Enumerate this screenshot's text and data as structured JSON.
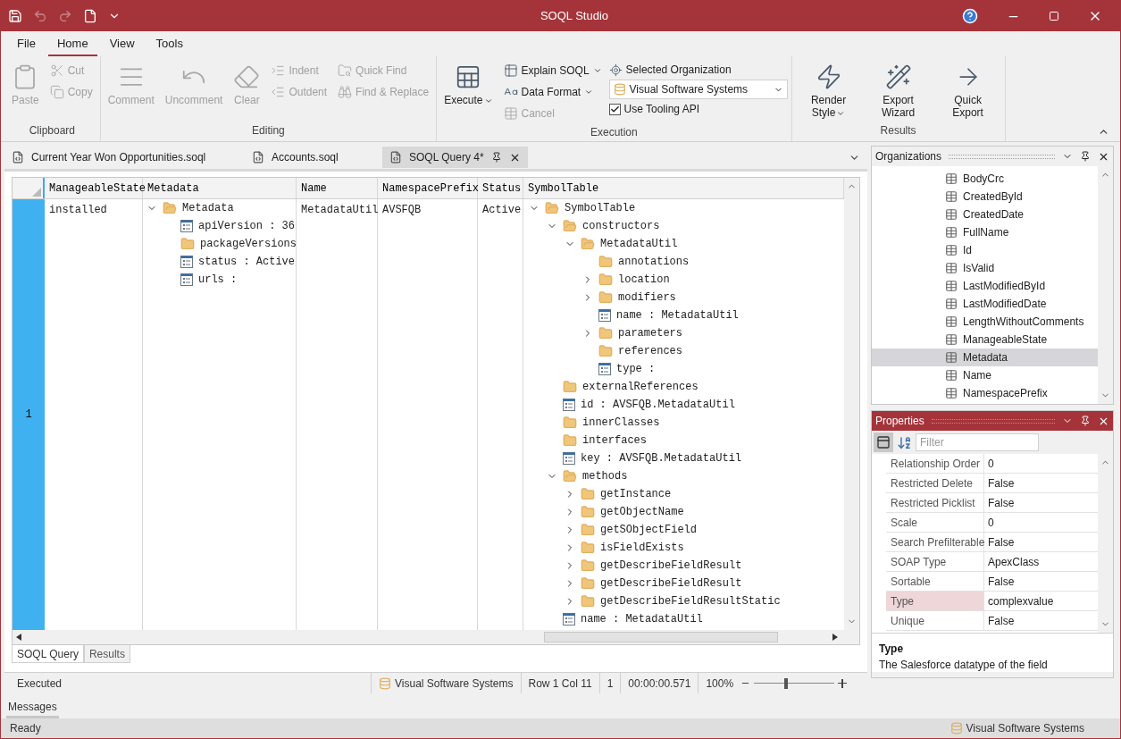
{
  "title_bar": {
    "title": "SOQL Studio"
  },
  "ribbon": {
    "tabs": [
      {
        "label": "File",
        "selected": false
      },
      {
        "label": "Home",
        "selected": true
      },
      {
        "label": "View",
        "selected": false
      },
      {
        "label": "Tools",
        "selected": false
      }
    ],
    "groups": [
      {
        "label": "Clipboard",
        "columns": [
          [
            {
              "kind": "large",
              "label": "Paste",
              "disabled": true,
              "menu": false
            }
          ],
          [
            {
              "kind": "small",
              "label": "Cut",
              "disabled": true,
              "menu": false
            },
            {
              "kind": "small",
              "label": "Copy",
              "disabled": true,
              "menu": false
            }
          ]
        ]
      },
      {
        "label": "Editing",
        "columns": [
          [
            {
              "kind": "large",
              "label": "Comment",
              "disabled": true,
              "menu": false
            }
          ],
          [
            {
              "kind": "large",
              "label": "Uncomment",
              "disabled": true,
              "menu": false
            }
          ],
          [
            {
              "kind": "large",
              "label": "Clear",
              "disabled": true,
              "menu": false
            }
          ],
          [
            {
              "kind": "small",
              "label": "Indent",
              "disabled": true,
              "menu": false
            },
            {
              "kind": "small",
              "label": "Outdent",
              "disabled": true,
              "menu": false
            }
          ],
          [
            {
              "kind": "small",
              "label": "Quick Find",
              "disabled": true,
              "menu": false
            },
            {
              "kind": "small",
              "label": "Find & Replace",
              "disabled": true,
              "menu": false
            }
          ]
        ]
      },
      {
        "label": "Execution",
        "columns": [
          [
            {
              "kind": "large",
              "label": "Execute",
              "disabled": false,
              "menu": true
            }
          ],
          [
            {
              "kind": "small",
              "label": "Explain SOQL",
              "disabled": false,
              "menu": true
            },
            {
              "kind": "small",
              "label": "Data Format",
              "disabled": false,
              "menu": true
            },
            {
              "kind": "small",
              "label": "Cancel",
              "disabled": true,
              "menu": false
            }
          ],
          [
            {
              "kind": "caption",
              "label": "Selected Organization"
            },
            {
              "kind": "combo",
              "value": "Visual Software Systems"
            },
            {
              "kind": "check",
              "label": "Use Tooling API",
              "checked": true
            }
          ]
        ]
      },
      {
        "label": "Results",
        "columns": [
          [
            {
              "kind": "large",
              "label": "Render Style",
              "disabled": false,
              "menu": true
            }
          ],
          [
            {
              "kind": "large",
              "label": "Export Wizard",
              "disabled": false,
              "menu": false
            }
          ],
          [
            {
              "kind": "large",
              "label": "Quick Export",
              "disabled": false,
              "menu": false
            }
          ]
        ]
      }
    ]
  },
  "document_tabs": [
    {
      "label": "Current Year Won Opportunities.soql",
      "selected": false
    },
    {
      "label": "Accounts.soql",
      "selected": false
    },
    {
      "label": "SOQL Query 4*",
      "selected": true
    }
  ],
  "grid": {
    "columns": [
      "ManageableState",
      "Metadata",
      "Name",
      "NamespacePrefix",
      "Status",
      "SymbolTable"
    ],
    "rows": [
      {
        "number": "1",
        "selected": true,
        "manageable_state": "installed",
        "metadata": {
          "label": "Metadata",
          "kind": "folder",
          "expanded": true,
          "children": [
            {
              "label": "apiVersion : 36",
              "kind": "field"
            },
            {
              "label": "packageVersions",
              "kind": "folder"
            },
            {
              "label": "status : Active",
              "kind": "field"
            },
            {
              "label": "urls :",
              "kind": "field"
            }
          ]
        },
        "name": "MetadataUtil",
        "namespace_prefix": "AVSFQB",
        "status": "Active",
        "symbol_table": {
          "label": "SymbolTable",
          "kind": "folder",
          "expanded": true,
          "children": [
            {
              "label": "constructors",
              "kind": "folder",
              "expanded": true,
              "children": [
                {
                  "label": "MetadataUtil",
                  "kind": "folder",
                  "expanded": true,
                  "children": [
                    {
                      "label": "annotations",
                      "kind": "folder"
                    },
                    {
                      "label": "location",
                      "kind": "folder",
                      "expanded": false
                    },
                    {
                      "label": "modifiers",
                      "kind": "folder",
                      "expanded": false
                    },
                    {
                      "label": "name : MetadataUtil",
                      "kind": "field"
                    },
                    {
                      "label": "parameters",
                      "kind": "folder",
                      "expanded": false
                    },
                    {
                      "label": "references",
                      "kind": "folder"
                    },
                    {
                      "label": "type :",
                      "kind": "field"
                    }
                  ]
                }
              ]
            },
            {
              "label": "externalReferences",
              "kind": "folder"
            },
            {
              "label": "id : AVSFQB.MetadataUtil",
              "kind": "field"
            },
            {
              "label": "innerClasses",
              "kind": "folder"
            },
            {
              "label": "interfaces",
              "kind": "folder"
            },
            {
              "label": "key : AVSFQB.MetadataUtil",
              "kind": "field"
            },
            {
              "label": "methods",
              "kind": "folder",
              "expanded": true,
              "children": [
                {
                  "label": "getInstance",
                  "kind": "folder",
                  "expanded": false
                },
                {
                  "label": "getObjectName",
                  "kind": "folder",
                  "expanded": false
                },
                {
                  "label": "getSObjectField",
                  "kind": "folder",
                  "expanded": false
                },
                {
                  "label": "isFieldExists",
                  "kind": "folder",
                  "expanded": false
                },
                {
                  "label": "getDescribeFieldResult",
                  "kind": "folder",
                  "expanded": false
                },
                {
                  "label": "getDescribeFieldResult",
                  "kind": "folder",
                  "expanded": false
                },
                {
                  "label": "getDescribeFieldResultStatic",
                  "kind": "folder",
                  "expanded": false
                }
              ]
            },
            {
              "label": "name : MetadataUtil",
              "kind": "field"
            }
          ]
        }
      }
    ]
  },
  "view_tabs": [
    {
      "label": "SOQL Query",
      "selected": true
    },
    {
      "label": "Results",
      "selected": false
    }
  ],
  "document_status": {
    "state": "Executed",
    "organization": "Visual Software Systems",
    "position": "Row 1 Col 11",
    "count": "1",
    "elapsed": "00:00:00.571",
    "zoom": "100%",
    "zoom_level": {
      "level": 0.4
    }
  },
  "organizations_panel": {
    "title": "Organizations",
    "items": [
      {
        "label": "BodyCrc",
        "selected": false
      },
      {
        "label": "CreatedById",
        "selected": false
      },
      {
        "label": "CreatedDate",
        "selected": false
      },
      {
        "label": "FullName",
        "selected": false
      },
      {
        "label": "Id",
        "selected": false
      },
      {
        "label": "IsValid",
        "selected": false
      },
      {
        "label": "LastModifiedById",
        "selected": false
      },
      {
        "label": "LastModifiedDate",
        "selected": false
      },
      {
        "label": "LengthWithoutComments",
        "selected": false
      },
      {
        "label": "ManageableState",
        "selected": false
      },
      {
        "label": "Metadata",
        "selected": true
      },
      {
        "label": "Name",
        "selected": false
      },
      {
        "label": "NamespacePrefix",
        "selected": false
      }
    ]
  },
  "properties_panel": {
    "title": "Properties",
    "filter": {
      "placeholder": "Filter"
    },
    "rows": [
      {
        "name": "Relationship Order",
        "value": "0",
        "selected": false
      },
      {
        "name": "Restricted Delete",
        "value": "False",
        "selected": false
      },
      {
        "name": "Restricted Picklist",
        "value": "False",
        "selected": false
      },
      {
        "name": "Scale",
        "value": "0",
        "selected": false
      },
      {
        "name": "Search Prefilterable",
        "value": "False",
        "selected": false
      },
      {
        "name": "SOAP Type",
        "value": "ApexClass",
        "selected": false
      },
      {
        "name": "Sortable",
        "value": "False",
        "selected": false
      },
      {
        "name": "Type",
        "value": "complexvalue",
        "selected": true
      },
      {
        "name": "Unique",
        "value": "False",
        "selected": false
      }
    ],
    "description": {
      "title": "Type",
      "text": "The Salesforce datatype of the field"
    }
  },
  "messages_tab": {
    "label": "Messages"
  },
  "status_bar": {
    "state": "Ready",
    "organization": "Visual Software Systems"
  }
}
